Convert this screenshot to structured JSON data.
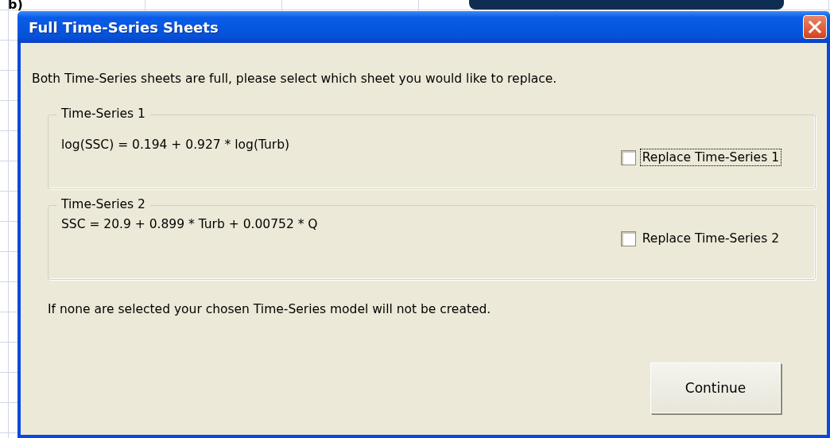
{
  "background": {
    "cell_text": "b)"
  },
  "window": {
    "title": "Full Time-Series Sheets"
  },
  "message": "Both Time-Series sheets are full, please select which sheet you would like to replace.",
  "groups": [
    {
      "title": "Time-Series 1",
      "equation": "log(SSC) = 0.194 + 0.927 * log(Turb)",
      "checkbox": {
        "label": "Replace Time-Series 1",
        "checked": false,
        "focused": true
      }
    },
    {
      "title": "Time-Series 2",
      "equation": "SSC = 20.9 + 0.899 * Turb + 0.00752 * Q",
      "checkbox": {
        "label": "Replace Time-Series 2",
        "checked": false,
        "focused": false
      }
    }
  ],
  "note": "If none are selected your chosen Time-Series model will not be created.",
  "buttons": [
    "Continue"
  ]
}
